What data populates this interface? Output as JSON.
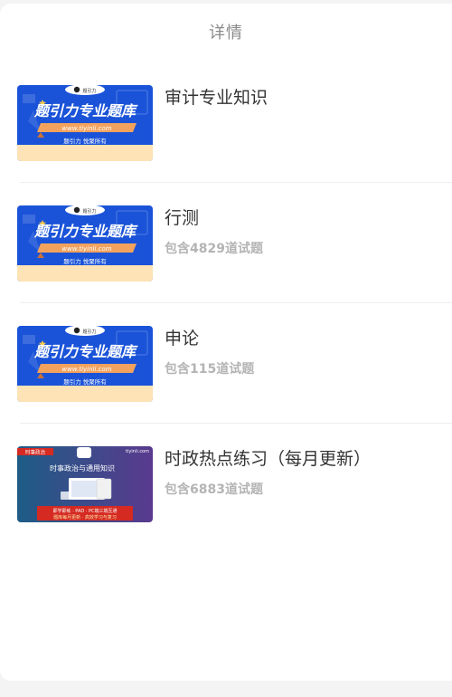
{
  "header": {
    "title": "详情"
  },
  "banner_blue": {
    "headline": "题引力专业题库",
    "url": "www.tiyinli.com",
    "slogan": "题引力 悦聚所有",
    "badge": "题引力",
    "colors": {
      "bg": "#1a53d8",
      "ribbon": "#f2a25d",
      "bottom": "#fde3b5"
    }
  },
  "banner_news": {
    "tag": "时事政治",
    "site": "tiyinli.com",
    "headline": "时事政治与通用知识",
    "line1": "即学即练 · PAD · PC端三端互通",
    "line2": "题库每月更新 · 高效学习与复习",
    "colors": {
      "left": "#1e5c86",
      "right": "#5a3a8e",
      "red": "#d42a22"
    }
  },
  "items": [
    {
      "title": "审计专业知识",
      "subtitle": "",
      "thumb": "blue"
    },
    {
      "title": "行测",
      "subtitle": "包含4829道试题",
      "thumb": "blue"
    },
    {
      "title": "申论",
      "subtitle": "包含115道试题",
      "thumb": "blue"
    },
    {
      "title": "时政热点练习（每月更新）",
      "subtitle": "包含6883道试题",
      "thumb": "news"
    }
  ]
}
